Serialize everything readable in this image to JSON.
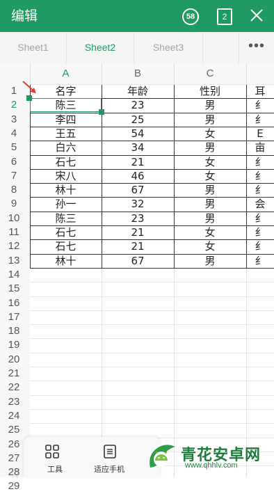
{
  "header": {
    "title": "编辑",
    "badge_count": "58",
    "sheet_count": "2",
    "close_icon": "close-icon"
  },
  "tabs": [
    {
      "label": "Sheet1",
      "active": false
    },
    {
      "label": "Sheet2",
      "active": true
    },
    {
      "label": "Sheet3",
      "active": false
    }
  ],
  "more_label": "•••",
  "columns": [
    "A",
    "B",
    "C"
  ],
  "active_column": "A",
  "active_row": 2,
  "rows": [
    [
      "名字",
      "年龄",
      "性别",
      "耳"
    ],
    [
      "陈三",
      "23",
      "男",
      "纟"
    ],
    [
      "李四",
      "25",
      "男",
      "纟"
    ],
    [
      "王五",
      "54",
      "女",
      "E"
    ],
    [
      "白六",
      "34",
      "男",
      "亩"
    ],
    [
      "石七",
      "21",
      "女",
      "纟"
    ],
    [
      "宋八",
      "46",
      "女",
      "纟"
    ],
    [
      "林十",
      "67",
      "男",
      "纟"
    ],
    [
      "孙一",
      "32",
      "男",
      "会"
    ],
    [
      "陈三",
      "23",
      "男",
      "纟"
    ],
    [
      "石七",
      "21",
      "女",
      "纟"
    ],
    [
      "石七",
      "21",
      "女",
      "纟"
    ],
    [
      "林十",
      "67",
      "男",
      "纟"
    ]
  ],
  "row_numbers": [
    "1",
    "2",
    "3",
    "4",
    "5",
    "6",
    "7",
    "8",
    "9",
    "10",
    "11",
    "12",
    "13",
    "14",
    "15",
    "16",
    "17",
    "18",
    "19",
    "20",
    "21",
    "22",
    "23",
    "24",
    "25",
    "26",
    "27",
    "28",
    "29"
  ],
  "toolbar": {
    "tools_label": "工具",
    "fit_label": "适应手机"
  },
  "watermark": {
    "name": "青花安卓网",
    "url": "www.qhhlv.com"
  },
  "colors": {
    "accent": "#1e9a62",
    "arrow": "#e53935"
  }
}
